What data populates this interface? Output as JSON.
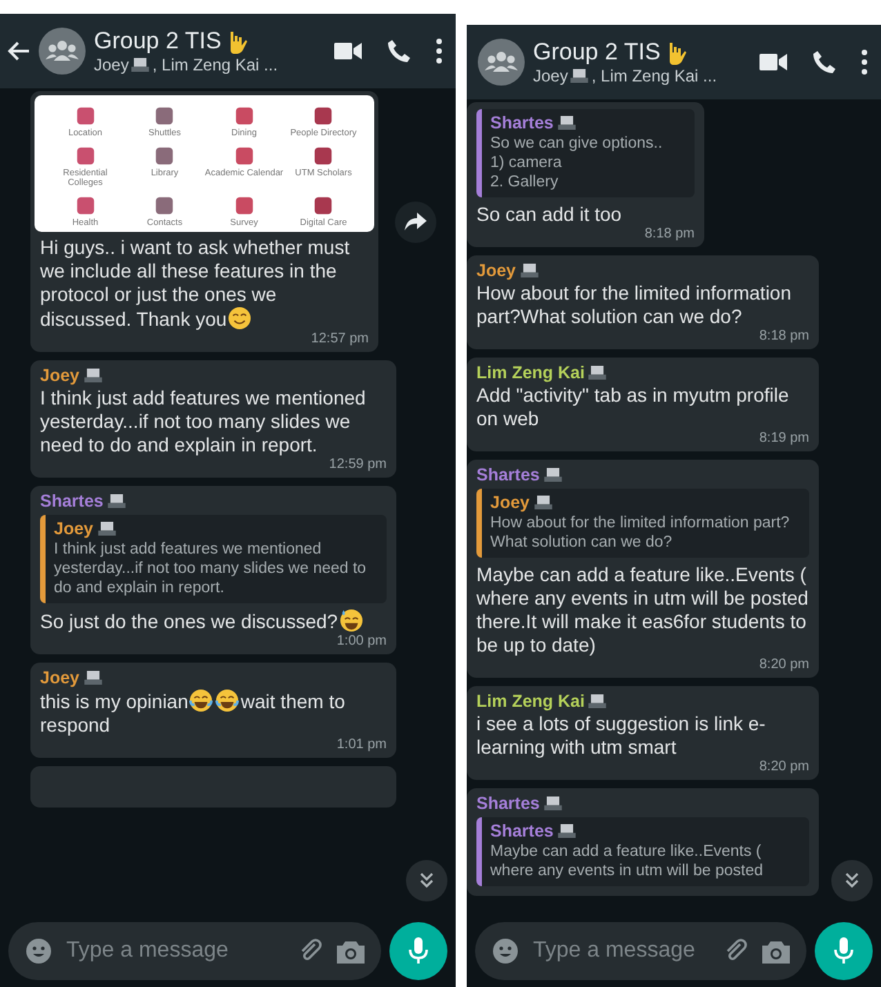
{
  "screens": [
    {
      "header": {
        "back_button": true,
        "title": "Group 2 TIS",
        "subtitle_name": "Joey",
        "subtitle_rest": ", Lim Zeng Kai ..."
      },
      "messages": [
        {
          "kind": "image",
          "image": {
            "tiles": [
              "Location",
              "Shuttles",
              "Dining",
              "People Directory",
              "Residential Colleges",
              "Library",
              "Academic Calendar",
              "UTM Scholars",
              "Health",
              "Contacts",
              "Survey",
              "Digital Care"
            ]
          },
          "body": [
            {
              "kind": "text",
              "text": "Hi guys.. i want to ask whether must we include all these features in the protocol or just the ones we discussed. Thank you"
            },
            {
              "kind": "emoji-smile"
            }
          ],
          "time": "12:57 pm",
          "forward": true
        },
        {
          "kind": "text",
          "sender": {
            "name": "Joey",
            "color": "#e39a3b"
          },
          "body": [
            {
              "kind": "text",
              "text": "I think just add features we mentioned yesterday...if not too many slides we need to do and explain in report."
            }
          ],
          "time": "12:59 pm"
        },
        {
          "kind": "text",
          "sender": {
            "name": "Shartes",
            "color": "#a57fd9"
          },
          "quote": {
            "name": "Joey",
            "color": "#e39a3b",
            "text": "I think just add features we mentioned yesterday...if not too many slides we need to do and explain in report."
          },
          "body": [
            {
              "kind": "text",
              "text": "So just do the ones we discussed?"
            },
            {
              "kind": "emoji-sweat"
            }
          ],
          "time": "1:00 pm"
        },
        {
          "kind": "text",
          "sender": {
            "name": "Joey",
            "color": "#e39a3b"
          },
          "body": [
            {
              "kind": "text",
              "text": "this is my opinian"
            },
            {
              "kind": "emoji-joy"
            },
            {
              "kind": "emoji-joy"
            },
            {
              "kind": "text",
              "text": "wait them to respond"
            }
          ],
          "time": "1:01 pm"
        },
        {
          "kind": "stub"
        }
      ],
      "composer": {
        "placeholder": "Type a message"
      }
    },
    {
      "header": {
        "back_button": false,
        "title": "Group 2 TIS",
        "subtitle_name": "Joey",
        "subtitle_rest": ", Lim Zeng Kai ..."
      },
      "messages": [
        {
          "kind": "text",
          "quote": {
            "name": "Shartes",
            "color": "#a57fd9",
            "text": "So we can give options..\n1) camera\n2. Gallery"
          },
          "body": [
            {
              "kind": "text",
              "text": "So can add it too"
            }
          ],
          "time": "8:18 pm"
        },
        {
          "kind": "text",
          "sender": {
            "name": "Joey",
            "color": "#e39a3b"
          },
          "body": [
            {
              "kind": "text",
              "text": "How about for the limited information part?What solution can we do?"
            }
          ],
          "time": "8:18 pm"
        },
        {
          "kind": "text",
          "sender": {
            "name": "Lim Zeng Kai",
            "color": "#b5d15a"
          },
          "body": [
            {
              "kind": "text",
              "text": "Add \"activity\" tab as in myutm profile on web"
            }
          ],
          "time": "8:19 pm"
        },
        {
          "kind": "text",
          "sender": {
            "name": "Shartes",
            "color": "#a57fd9"
          },
          "quote": {
            "name": "Joey",
            "color": "#e39a3b",
            "text": "How about for the limited information part?What solution can we do?"
          },
          "body": [
            {
              "kind": "text",
              "text": "Maybe can add a feature like..Events ( where any events in utm will be posted there.It will make it eas6for students to be up to date)"
            }
          ],
          "time": "8:20 pm"
        },
        {
          "kind": "text",
          "sender": {
            "name": "Lim Zeng Kai",
            "color": "#b5d15a"
          },
          "body": [
            {
              "kind": "text",
              "text": "i see a lots of suggestion is link e-learning with utm smart"
            }
          ],
          "time": "8:20 pm"
        },
        {
          "kind": "text",
          "sender": {
            "name": "Shartes",
            "color": "#a57fd9"
          },
          "quote": {
            "name": "Shartes",
            "color": "#a57fd9",
            "text": "Maybe can add a feature like..Events ( where any events in utm will be posted"
          }
        }
      ],
      "composer": {
        "placeholder": "Type a message"
      }
    }
  ]
}
